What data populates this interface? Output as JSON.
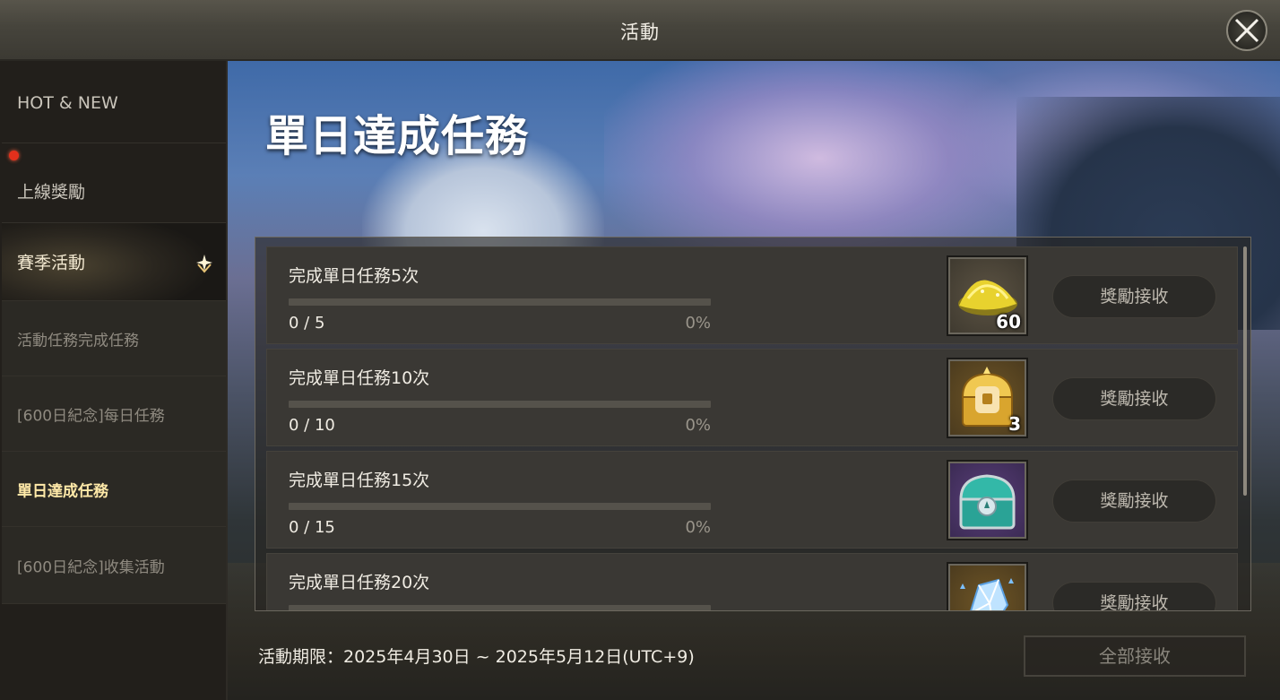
{
  "window": {
    "title": "活動"
  },
  "sidebar": {
    "items": [
      {
        "label": "HOT & NEW"
      },
      {
        "label": "上線獎勵"
      },
      {
        "label": "賽季活動"
      },
      {
        "label": "活動任務完成任務"
      },
      {
        "label": "[600日紀念]每日任務"
      },
      {
        "label": "單日達成任務"
      },
      {
        "label": "[600日紀念]收集活動"
      }
    ],
    "active_item": "單日達成任務",
    "colors": {
      "notification_dot": "#e2301c",
      "active_text": "#ffe9a8"
    }
  },
  "event": {
    "title": "單日達成任務",
    "missions": [
      {
        "title": "完成單日任務5次",
        "progress": "0 / 5",
        "percent": "0%",
        "progress_fraction": 0,
        "reward_icon": "gold-dust-icon",
        "reward_qty": "60",
        "claim_label": "獎勵接收"
      },
      {
        "title": "完成單日任務10次",
        "progress": "0 / 10",
        "percent": "0%",
        "progress_fraction": 0,
        "reward_icon": "golden-chest-icon",
        "reward_qty": "3",
        "claim_label": "獎勵接收"
      },
      {
        "title": "完成單日任務15次",
        "progress": "0 / 15",
        "percent": "0%",
        "progress_fraction": 0,
        "reward_icon": "jade-chest-icon",
        "reward_qty": "",
        "claim_label": "獎勵接收"
      },
      {
        "title": "完成單日任務20次",
        "reward_icon": "crystal-icon",
        "claim_label": "獎勵接收"
      }
    ],
    "period": "活動期限：2025年4月30日 ~ 2025年5月12日(UTC+9)",
    "claim_all_label": "全部接收"
  }
}
